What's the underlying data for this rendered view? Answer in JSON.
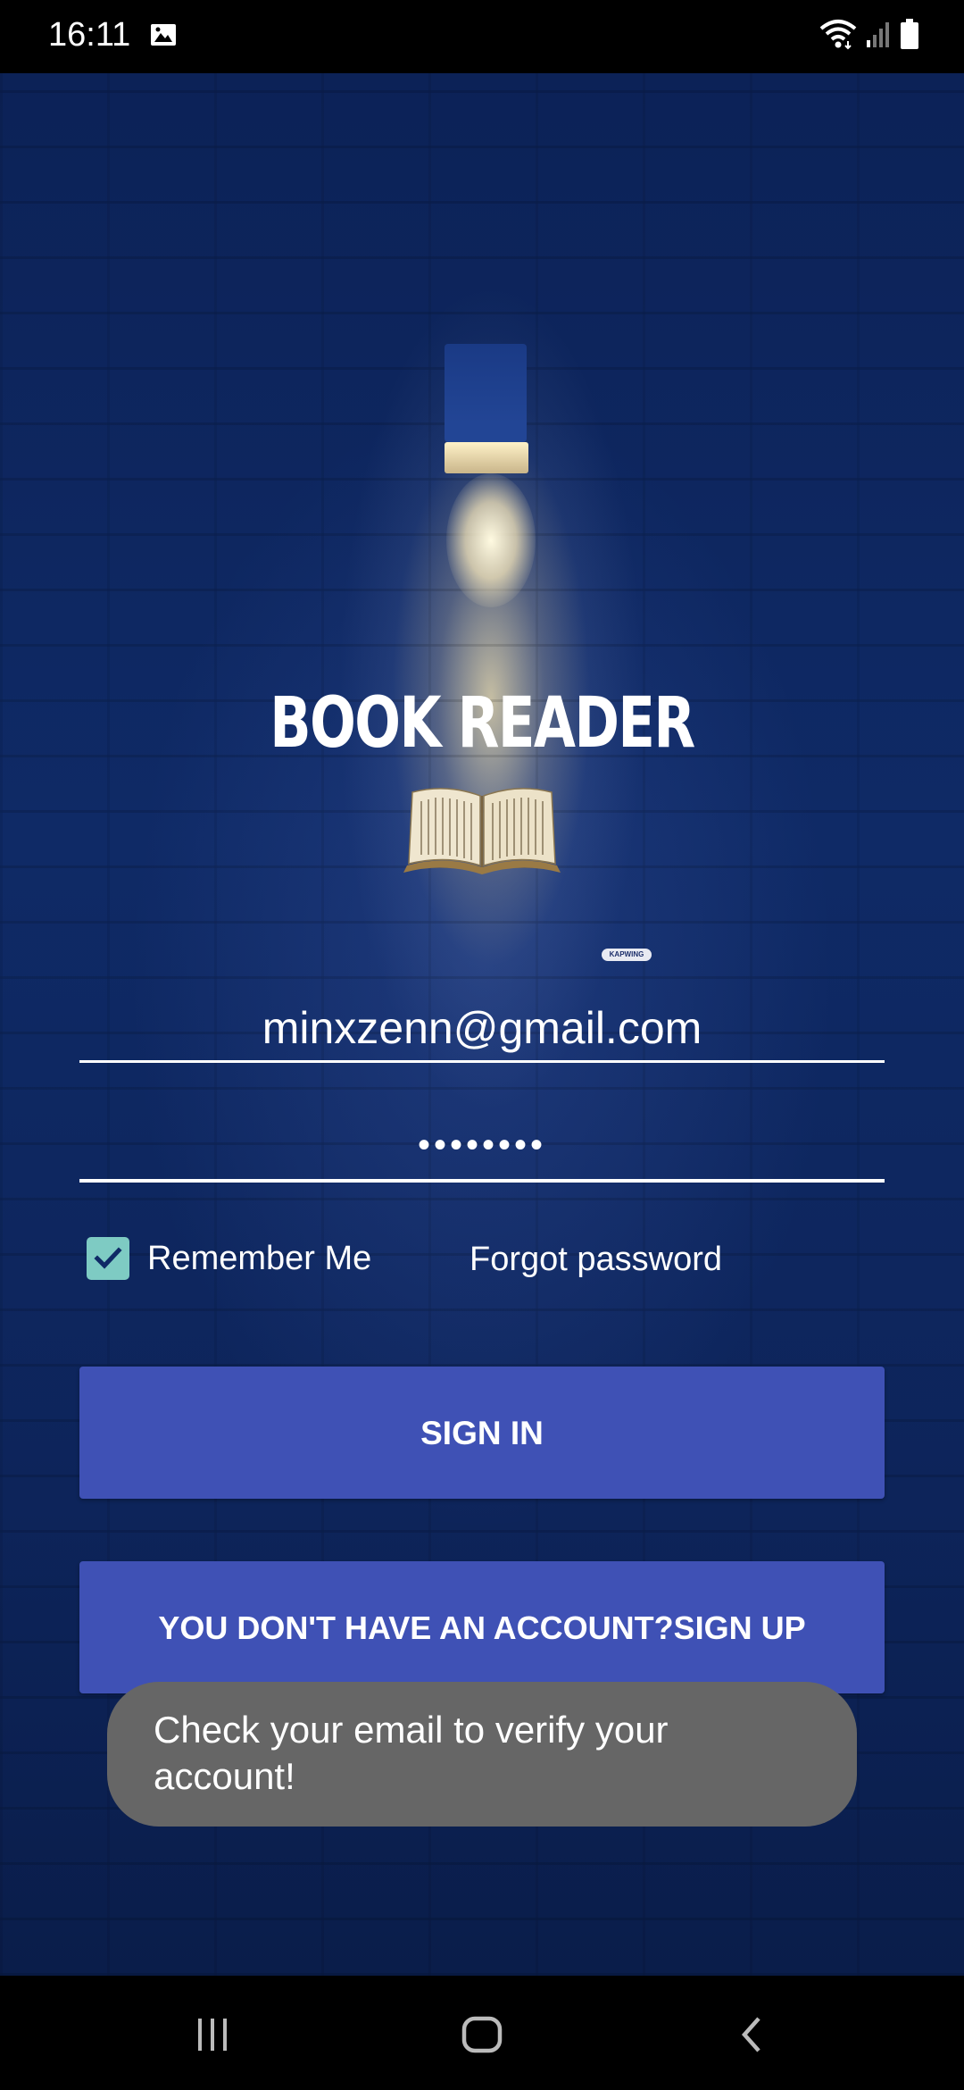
{
  "status_bar": {
    "time": "16:11",
    "icons": [
      "image-icon",
      "wifi-icon",
      "signal-icon",
      "battery-icon"
    ]
  },
  "app": {
    "title": "BOOK READER",
    "watermark": "KAPWING"
  },
  "login": {
    "email_value": "minxzenn@gmail.com",
    "password_value": "••••••••",
    "remember_me_label": "Remember Me",
    "remember_me_checked": true,
    "forgot_password_label": "Forgot password",
    "sign_in_label": "SIGN IN",
    "sign_up_label": "YOU DON'T HAVE AN ACCOUNT?SIGN UP"
  },
  "toast": {
    "message": "Check your email to verify your account!"
  },
  "colors": {
    "accent_button": "#3f51b5",
    "checkbox": "#7ecbc3",
    "background": "#0f2a66",
    "toast": "#666666"
  },
  "nav": {
    "items": [
      "recent-apps-icon",
      "home-icon",
      "back-icon"
    ]
  }
}
